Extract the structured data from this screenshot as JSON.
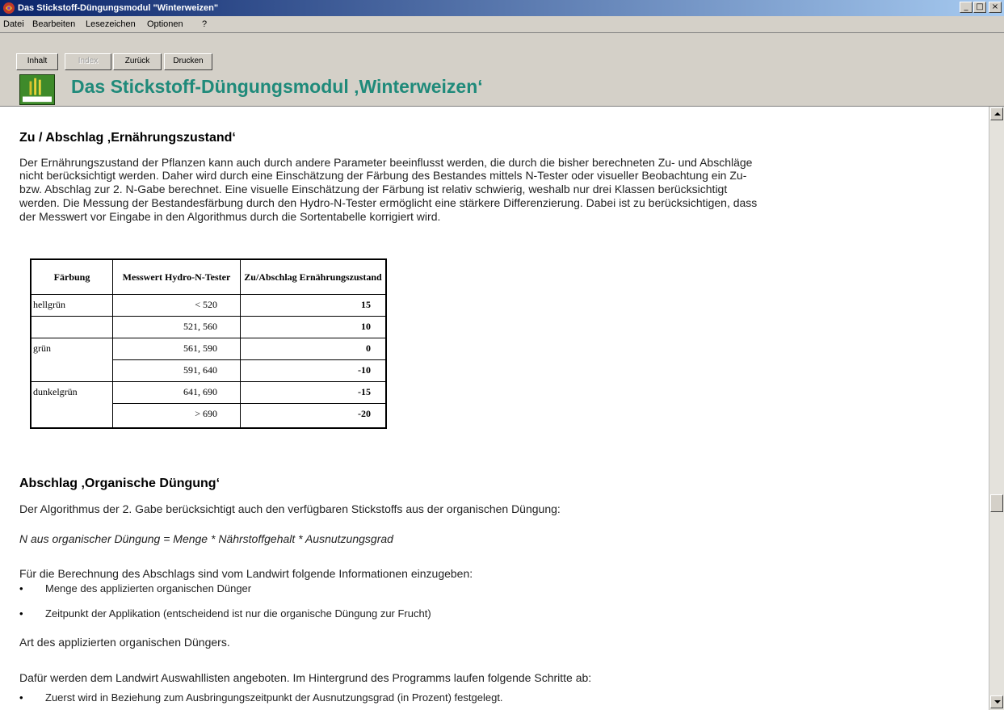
{
  "window": {
    "title": "Das Stickstoff-Düngungsmodul \"Winterweizen\"",
    "controls": {
      "minimize": "_",
      "maximize": "□",
      "close": "×"
    }
  },
  "menu": [
    "Datei",
    "Bearbeiten",
    "Lesezeichen",
    "Optionen",
    "?"
  ],
  "toolbar": {
    "inhalt": "Inhalt",
    "index": "Index",
    "zurueck": "Zurück",
    "drucken": "Drucken"
  },
  "header": {
    "title": "Das Stickstoff-Düngungsmodul ‚Winterweizen‘"
  },
  "section1": {
    "heading": "Zu / Abschlag ‚Ernährungszustand‘",
    "lines": [
      "Der Ernährungszustand der Pflanzen kann auch durch andere Parameter beeinflusst werden, die durch die bisher berechneten Zu- und Abschläge",
      "nicht berücksichtigt werden. Daher wird durch eine Einschätzung der Färbung des Bestandes mittels N-Tester oder visueller Beobachtung ein Zu-",
      "bzw. Abschlag zur 2. N-Gabe berechnet. Eine visuelle Einschätzung der Färbung ist relativ schwierig, weshalb nur drei Klassen berücksichtigt",
      "werden. Die Messung der Bestandesfärbung durch den Hydro-N-Tester ermöglicht eine stärkere Differenzierung. Dabei ist zu berücksichtigen, dass",
      "der Messwert vor Eingabe in den Algorithmus durch die Sortentabelle korrigiert wird."
    ]
  },
  "table": {
    "headers": [
      "Färbung",
      "Messwert Hydro-N-Tester",
      "Zu/Abschlag Ernährungszustand"
    ],
    "rows": [
      [
        "hellgrün",
        "< 520",
        "15"
      ],
      [
        "",
        "521, 560",
        "10"
      ],
      [
        "grün",
        "561, 590",
        "0"
      ],
      [
        "",
        "591, 640",
        "-10"
      ],
      [
        "dunkelgrün",
        "641, 690",
        "-15"
      ],
      [
        "",
        "> 690",
        "-20"
      ]
    ]
  },
  "section2": {
    "heading": "Abschlag ‚Organische Düngung‘",
    "intro": "Der Algorithmus der 2. Gabe berücksichtigt auch den verfügbaren Stickstoffs aus der organischen Düngung:",
    "formula": "N aus organischer Düngung = Menge * Nährstoffgehalt * Ausnutzungsgrad",
    "info": "Für die Berechnung des Abschlags sind vom Landwirt folgende Informationen einzugeben:",
    "bullets": [
      "Menge des applizierten organischen Dünger",
      "Zeitpunkt der Applikation (entscheidend ist nur die organische Düngung zur Frucht)"
    ],
    "art": "Art des applizierten organischen Düngers.",
    "list_intro": "Dafür werden dem Landwirt Auswahllisten angeboten. Im Hintergrund des Programms laufen folgende Schritte ab:",
    "steps": [
      "Zuerst wird in Beziehung zum Ausbringungszeitpunkt der Ausnutzungsgrad (in Prozent) festgelegt."
    ]
  }
}
